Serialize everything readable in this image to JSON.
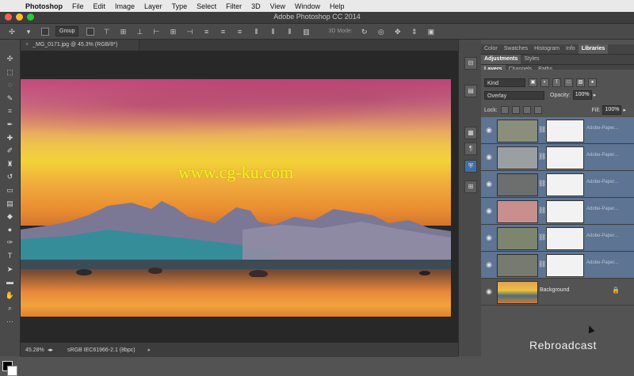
{
  "menubar": {
    "app_name": "Photoshop",
    "items": [
      "File",
      "Edit",
      "Image",
      "Layer",
      "Type",
      "Select",
      "Filter",
      "3D",
      "View",
      "Window",
      "Help"
    ]
  },
  "window": {
    "title": "Adobe Photoshop CC 2014"
  },
  "options_bar": {
    "group_select": "Group",
    "mode_3d": "3D Mode:"
  },
  "document": {
    "tab_title": "_MG_0171.jpg @ 45.3% (RGB/8*)",
    "watermark": "www.cg-ku.com"
  },
  "status": {
    "zoom": "45.28%",
    "profile": "sRGB IEC61966-2.1 (8bpc)"
  },
  "panels": {
    "top_tabs": [
      "Color",
      "Swatches",
      "Histogram",
      "Info",
      "Libraries"
    ],
    "top_active": "Libraries",
    "mid_tabs": [
      "Adjustments",
      "Styles"
    ],
    "mid_active": "Adjustments",
    "layer_tabs": [
      "Layers",
      "Channels",
      "Paths"
    ],
    "layer_active": "Layers"
  },
  "layers_panel": {
    "filter_kind": "Kind",
    "blend_mode": "Overlay",
    "opacity_label": "Opacity:",
    "opacity_value": "100%",
    "lock_label": "Lock:",
    "fill_label": "Fill:",
    "fill_value": "100%",
    "layers": [
      {
        "name": "Adobe-Paper...",
        "thumb": "#8a8e7a"
      },
      {
        "name": "Adobe-Paper...",
        "thumb": "#9aa0a2"
      },
      {
        "name": "Adobe-Paper...",
        "thumb": "#6d6e6e"
      },
      {
        "name": "Adobe-Paper...",
        "thumb": "#c98f8f"
      },
      {
        "name": "Adobe-Paper...",
        "thumb": "#7e856e"
      },
      {
        "name": "Adobe-Paper...",
        "thumb": "#767a6f"
      },
      {
        "name": "Background",
        "thumb": "#d07a3a"
      }
    ]
  },
  "overlay": {
    "brand": "Rebroadcast"
  }
}
